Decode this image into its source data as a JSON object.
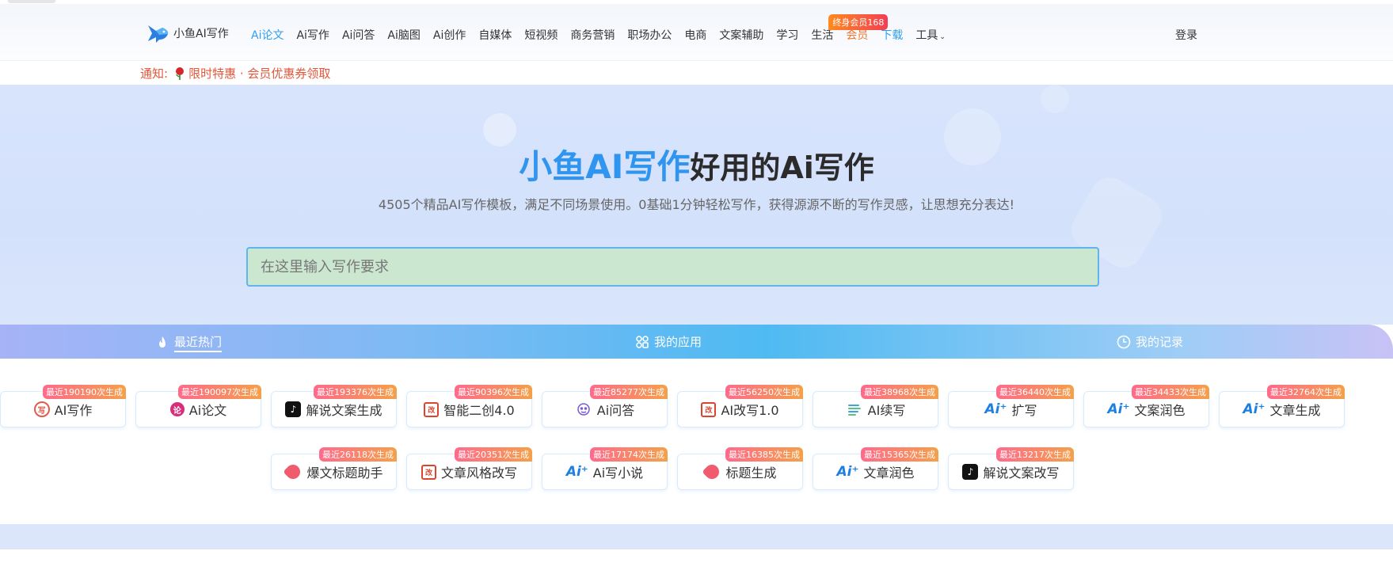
{
  "header": {
    "logo_text": "小鱼AI写作",
    "nav": [
      {
        "label": "Ai论文",
        "style": "active"
      },
      {
        "label": "Ai写作",
        "style": ""
      },
      {
        "label": "Ai问答",
        "style": ""
      },
      {
        "label": "Ai脑图",
        "style": ""
      },
      {
        "label": "Ai创作",
        "style": ""
      },
      {
        "label": "自媒体",
        "style": ""
      },
      {
        "label": "短视频",
        "style": ""
      },
      {
        "label": "商务营销",
        "style": ""
      },
      {
        "label": "职场办公",
        "style": ""
      },
      {
        "label": "电商",
        "style": ""
      },
      {
        "label": "文案辅助",
        "style": ""
      },
      {
        "label": "学习",
        "style": ""
      },
      {
        "label": "生活",
        "style": ""
      },
      {
        "label": "会员",
        "style": "vip"
      },
      {
        "label": "下载",
        "style": "download"
      },
      {
        "label": "工具",
        "style": "tools"
      }
    ],
    "vip_badge": "终身会员168",
    "login": "登录"
  },
  "notice": {
    "prefix": "通知:",
    "text": "限时特惠 · 会员优惠券领取"
  },
  "hero": {
    "brand": "小鱼AI写作",
    "slogan": "好用的Ai写作",
    "subtitle": "4505个精品AI写作模板，满足不同场景使用。0基础1分钟轻松写作，获得源源不断的写作灵感，让思想充分表达!",
    "search_placeholder": "在这里输入写作要求"
  },
  "tabs": [
    {
      "label": "最近热门",
      "icon": "fire-icon",
      "active": true
    },
    {
      "label": "我的应用",
      "icon": "grid-icon",
      "active": false
    },
    {
      "label": "我的记录",
      "icon": "clock-icon",
      "active": false
    }
  ],
  "cards": [
    {
      "label": "AI写作",
      "badge": "最近190190次生成",
      "icon": "ai-write-icon"
    },
    {
      "label": "Ai论文",
      "badge": "最近190097次生成",
      "icon": "paper-icon"
    },
    {
      "label": "解说文案生成",
      "badge": "最近193376次生成",
      "icon": "tiktok-icon"
    },
    {
      "label": "智能二创4.0",
      "badge": "最近90396次生成",
      "icon": "rewrite-icon"
    },
    {
      "label": "Ai问答",
      "badge": "最近85277次生成",
      "icon": "qa-icon"
    },
    {
      "label": "AI改写1.0",
      "badge": "最近56250次生成",
      "icon": "rewrite-icon"
    },
    {
      "label": "AI续写",
      "badge": "最近38968次生成",
      "icon": "continue-icon"
    },
    {
      "label": "扩写",
      "badge": "最近36440次生成",
      "icon": "ai-sparkle-icon"
    },
    {
      "label": "文案润色",
      "badge": "最近34433次生成",
      "icon": "ai-sparkle-icon"
    },
    {
      "label": "文章生成",
      "badge": "最近32764次生成",
      "icon": "ai-sparkle-icon"
    },
    {
      "label": "爆文标题助手",
      "badge": "最近26118次生成",
      "icon": "tag-icon"
    },
    {
      "label": "文章风格改写",
      "badge": "最近20351次生成",
      "icon": "rewrite-icon"
    },
    {
      "label": "Ai写小说",
      "badge": "最近17174次生成",
      "icon": "ai-sparkle-icon"
    },
    {
      "label": "标题生成",
      "badge": "最近16385次生成",
      "icon": "tag-icon"
    },
    {
      "label": "文章润色",
      "badge": "最近15365次生成",
      "icon": "ai-sparkle-icon"
    },
    {
      "label": "解说文案改写",
      "badge": "最近13217次生成",
      "icon": "tiktok-icon"
    }
  ]
}
